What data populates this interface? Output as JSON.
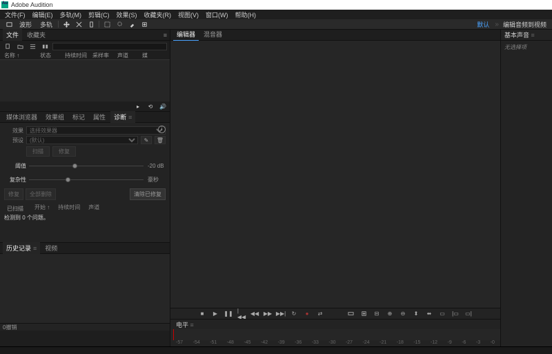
{
  "app": {
    "title": "Adobe Audition"
  },
  "menu": [
    "文件(F)",
    "编辑(E)",
    "多轨(M)",
    "剪辑(C)",
    "效果(S)",
    "收藏夹(R)",
    "视图(V)",
    "窗口(W)",
    "帮助(H)"
  ],
  "toolbar": {
    "waveform": "波形",
    "multitrack": "多轨",
    "default_link": "默认",
    "edit_export": "编辑音频到视频"
  },
  "files_panel": {
    "tabs": {
      "files": "文件",
      "favorites": "收藏夹"
    },
    "headers": {
      "name": "名称 ↑",
      "status": "状态",
      "duration": "持续时间",
      "samplerate": "采样率",
      "channels": "声道",
      "more": "媒"
    }
  },
  "media_panel": {
    "tabs": {
      "browser": "媒体浏览器",
      "rack": "效果组",
      "markers": "标记",
      "properties": "属性",
      "diagnostics": "诊断"
    },
    "effect_label": "效果",
    "effect_placeholder": "选择效果器",
    "preset_label": "预设",
    "preset_placeholder": "(默认)",
    "scan_btn": "扫描",
    "repair_btn": "修复",
    "threshold_label": "阈值",
    "threshold_value": "-20 dB",
    "complexity_label": "复杂性",
    "complexity_value": "豪秒",
    "radius_btn": "修复",
    "delete_btn": "全部删除",
    "radius_value": "清除已修复",
    "diag_scanned": "已扫描",
    "diag_start": "开始 ↑",
    "diag_duration": "持续时间",
    "diag_channel": "声道",
    "status_text": "检测到 0 个问题。"
  },
  "history_panel": {
    "tabs": {
      "history": "历史记录",
      "video": "视频"
    }
  },
  "undo_footer": "0撤销",
  "editor": {
    "tabs": {
      "editor": "编辑器",
      "mixer": "混音器"
    }
  },
  "levels": {
    "label": "电平",
    "scale": [
      "57",
      "54",
      "51",
      "48",
      "45",
      "42",
      "39",
      "36",
      "33",
      "30",
      "27",
      "24",
      "21",
      "18",
      "15",
      "12",
      "9",
      "6",
      "3",
      "0"
    ]
  },
  "essential_sound": {
    "title": "基本声音",
    "no_selection": "无选择项"
  }
}
